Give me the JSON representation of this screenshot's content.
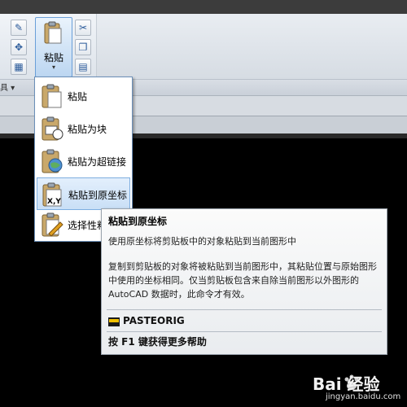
{
  "ribbon": {
    "panel_label": "具 ▾",
    "paste_button": {
      "label": "粘贴",
      "arrow": "▾"
    },
    "tools_left": [
      "match-properties-icon",
      "move-icon",
      "calculator-icon"
    ],
    "tools_right": [
      "cut-icon",
      "copy-icon",
      "paste-format-icon"
    ]
  },
  "dropdown": {
    "items": [
      {
        "label": "粘贴",
        "icon": "paste-icon",
        "active": false
      },
      {
        "label": "粘贴为块",
        "icon": "paste-as-block-icon",
        "active": false
      },
      {
        "label": "粘贴为超链接",
        "icon": "paste-as-hyperlink-icon",
        "active": false
      },
      {
        "label": "粘贴到原坐标",
        "icon": "paste-to-original-coordinates-icon",
        "active": true,
        "icon_text": "X,Y"
      },
      {
        "label": "选择性粘",
        "icon": "paste-special-icon",
        "active": false
      }
    ]
  },
  "tooltip": {
    "title": "粘贴到原坐标",
    "summary": "使用原坐标将剪贴板中的对象粘贴到当前图形中",
    "body": "复制到剪贴板的对象将被粘贴到当前图形中，其粘贴位置与原始图形中使用的坐标相同。仅当剪贴板包含来自除当前图形以外图形的 AutoCAD 数据时，此命令才有效。",
    "command": "PASTEORIG",
    "help": "按 F1 键获得更多帮助"
  },
  "watermark": {
    "brand": "Bai 经验",
    "url": "jingyan.baidu.com"
  },
  "colors": {
    "accent": "#6a9fd8",
    "canvas": "#000000",
    "ribbon": "#e4e9ef"
  }
}
